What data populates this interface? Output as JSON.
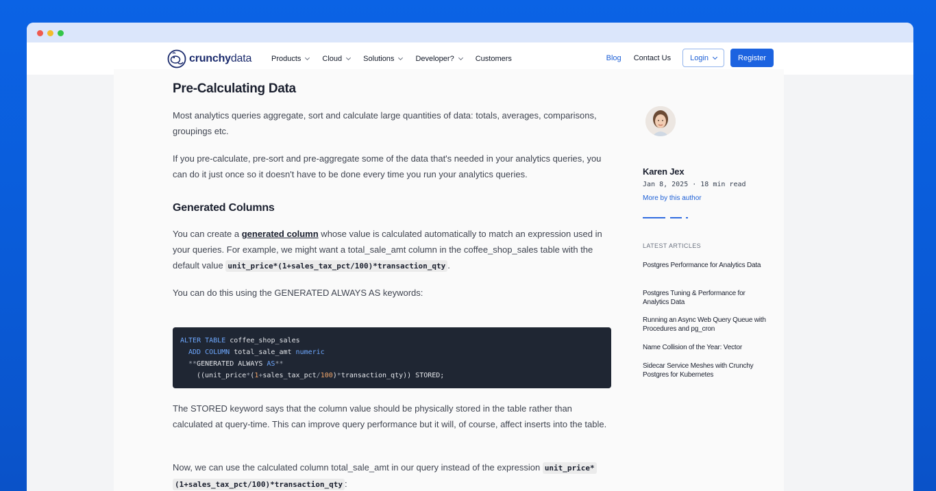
{
  "nav": {
    "brand_bold": "crunchy",
    "brand_light": "data",
    "items": [
      "Products",
      "Cloud",
      "Solutions",
      "Developer?",
      "Customers"
    ],
    "blog": "Blog",
    "contact": "Contact Us",
    "login": "Login",
    "register": "Register"
  },
  "article": {
    "title": "Pre-Calculating Data",
    "p1": "Most analytics queries aggregate, sort and calculate large quantities of data: totals, averages, comparisons, groupings etc.",
    "p2": "If you pre-calculate, pre-sort and pre-aggregate some of the data that's needed in your analytics queries, you can do it just once so it doesn't have to be done every time you run your analytics queries.",
    "h2": "Generated Columns",
    "p3_a": "You can create a ",
    "p3_link": "generated column",
    "p3_b": " whose value is calculated automatically to match an expression used in your queries. For example, we might want a total_sale_amt column in the coffee_shop_sales table with the default value ",
    "p3_code": "unit_price*(1+sales_tax_pct/100)*transaction_qty",
    "p3_c": ".",
    "p4": "You can do this using the GENERATED ALWAYS AS keywords:",
    "code": {
      "l1_kw": "ALTER TABLE",
      "l1_rest": " coffee_shop_sales",
      "l2_kw": "ADD COLUMN",
      "l2_rest": " total_sale_amt ",
      "l2_type": "numeric",
      "l3_a": "**",
      "l3_b": "GENERATED ALWAYS ",
      "l3_kw": "AS",
      "l3_c": "**",
      "l4_a": "((unit_price",
      "l4_op1": "*",
      "l4_b": "(",
      "l4_n1": "1",
      "l4_op2": "+",
      "l4_c": "sales_tax_pct",
      "l4_op3": "/",
      "l4_n2": "100",
      "l4_d": ")",
      "l4_op4": "*",
      "l4_e": "transaction_qty)) STORED;"
    },
    "p5": "The STORED keyword says that the column value should be physically stored in the table rather than calculated at query-time. This can improve query performance but it will, of course, affect inserts into the table.",
    "p6_a": "Now, we can use the calculated column total_sale_amt in our query instead of the expression ",
    "p6_code1": "unit_price*",
    "p6_code2": "(1+sales_tax_pct/100)*transaction_qty",
    "p6_b": ":"
  },
  "sidebar": {
    "author_name": "Karen Jex",
    "author_meta": "Jan 8, 2025 · 18 min read",
    "author_link": "More by this author",
    "latest_title": "LATEST ARTICLES",
    "latest": [
      "Postgres Performance for Analytics Data",
      "Postgres Tuning & Performance for Analytics Data",
      "Running an Async Web Query Queue with Procedures and pg_cron",
      "Name Collision of the Year: Vector",
      "Sidecar Service Meshes with Crunchy Postgres for Kubernetes"
    ]
  },
  "colors": {
    "background": "#0b63e5",
    "accent": "#1c63e0",
    "code_bg": "#1f2633"
  }
}
